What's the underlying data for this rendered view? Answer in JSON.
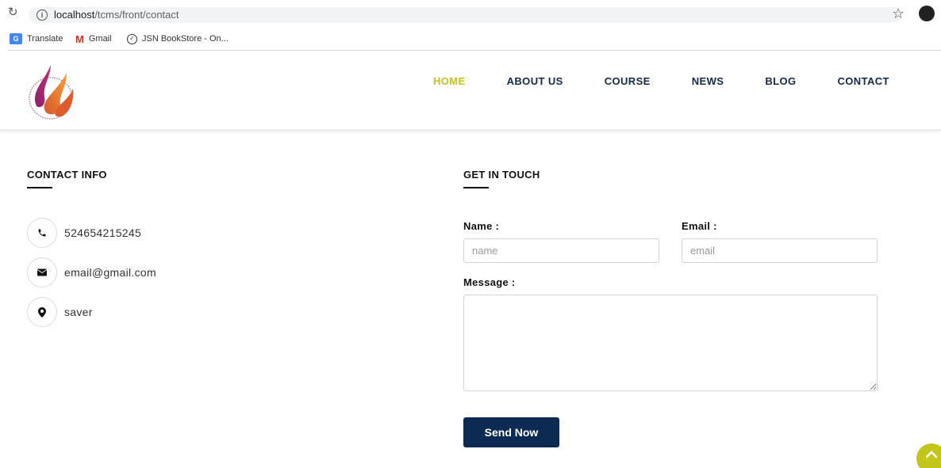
{
  "browser": {
    "url_host": "localhost",
    "url_path": "/tcms/front/contact",
    "bookmarks": [
      {
        "label": "Translate"
      },
      {
        "label": "Gmail"
      },
      {
        "label": "JSN BookStore - On..."
      }
    ]
  },
  "nav": {
    "items": [
      "HOME",
      "ABOUT US",
      "COURSE",
      "NEWS",
      "BLOG",
      "CONTACT"
    ],
    "active": "HOME",
    "colors": {
      "text": "#13294b",
      "active": "#c2c51a"
    }
  },
  "contact_info": {
    "title": "CONTACT INFO",
    "phone": "524654215245",
    "email": "email@gmail.com",
    "address": "saver"
  },
  "form": {
    "title": "GET IN TOUCH",
    "name_label": "Name :",
    "name_placeholder": "name",
    "email_label": "Email :",
    "email_placeholder": "email",
    "message_label": "Message :",
    "submit_label": "Send Now",
    "button_color": "#0d2b52"
  }
}
